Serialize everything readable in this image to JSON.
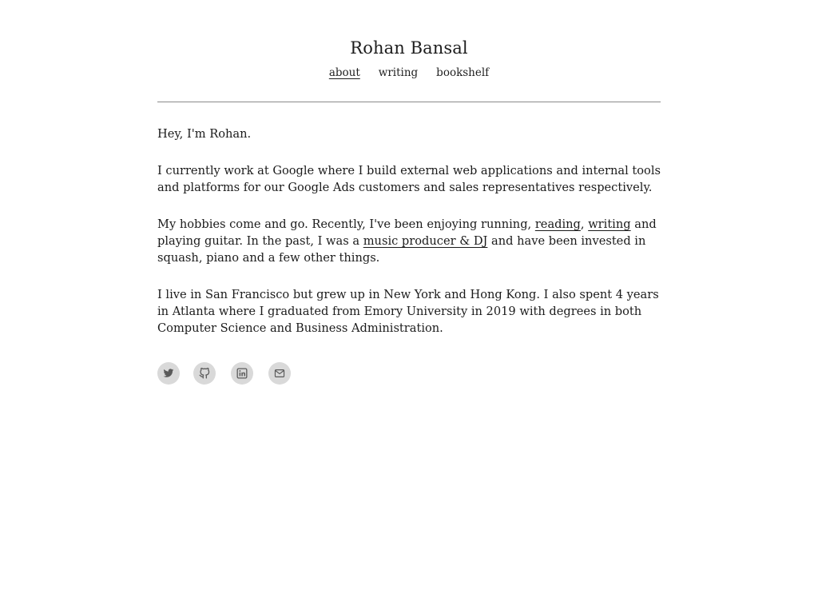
{
  "header": {
    "title": "Rohan Bansal",
    "nav": [
      {
        "label": "about",
        "active": true
      },
      {
        "label": "writing",
        "active": false
      },
      {
        "label": "bookshelf",
        "active": false
      }
    ]
  },
  "about": {
    "greeting": "Hey, I'm Rohan.",
    "work": "I currently work at Google where I build external web applications and internal tools and platforms for our Google Ads customers and sales representatives respectively.",
    "hobbies": {
      "intro": "My hobbies come and go. Recently, I've been enjoying running, ",
      "link_reading": "reading",
      "sep1": ", ",
      "link_writing": "writing",
      "mid": " and playing guitar. In the past, I was a ",
      "link_music": "music producer & DJ",
      "outro": " and have been invested in squash, piano and a few other things."
    },
    "location": "I live in San Francisco but grew up in New York and Hong Kong. I also spent 4 years in Atlanta where I graduated from Emory University in 2019 with degrees in both Computer Science and Business Administration."
  },
  "socials": [
    {
      "icon": "twitter-icon"
    },
    {
      "icon": "github-icon"
    },
    {
      "icon": "linkedin-icon"
    },
    {
      "icon": "mail-icon"
    }
  ],
  "colors": {
    "text": "#1b1b1b",
    "rule": "#8a8a8a",
    "social_bg": "#d9d9d9",
    "social_icon": "#555555"
  }
}
